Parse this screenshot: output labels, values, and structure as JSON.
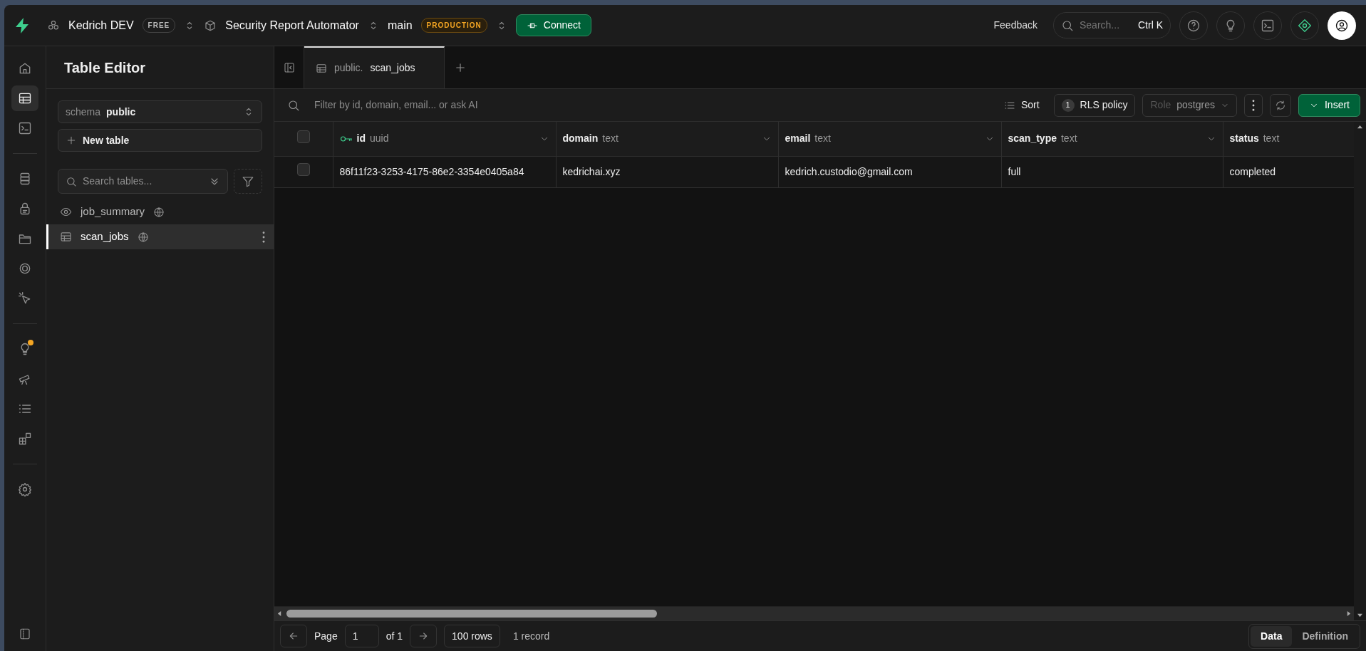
{
  "topbar": {
    "org": "Kedrich DEV",
    "org_badge": "FREE",
    "project": "Security Report Automator",
    "branch": "main",
    "branch_badge": "PRODUCTION",
    "connect": "Connect",
    "feedback": "Feedback",
    "search_placeholder": "Search...",
    "search_shortcut": "Ctrl K"
  },
  "rail_groups": [
    [
      {
        "kind": "home",
        "selected": false,
        "notification": false
      },
      {
        "kind": "table",
        "selected": true,
        "notification": false
      },
      {
        "kind": "terminal",
        "selected": false,
        "notification": false
      }
    ],
    [
      {
        "kind": "database",
        "selected": false,
        "notification": false
      },
      {
        "kind": "lock",
        "selected": false,
        "notification": false
      },
      {
        "kind": "folder",
        "selected": false,
        "notification": false
      },
      {
        "kind": "orbit",
        "selected": false,
        "notification": false
      },
      {
        "kind": "cursor",
        "selected": false,
        "notification": false
      }
    ],
    [
      {
        "kind": "bulb",
        "selected": false,
        "notification": true
      },
      {
        "kind": "telescope",
        "selected": false,
        "notification": false
      },
      {
        "kind": "list",
        "selected": false,
        "notification": false
      },
      {
        "kind": "blocks",
        "selected": false,
        "notification": false
      }
    ],
    [
      {
        "kind": "gear",
        "selected": false,
        "notification": false
      }
    ]
  ],
  "sidebar": {
    "title": "Table Editor",
    "schema_label": "schema",
    "schema_value": "public",
    "new_table": "New table",
    "search_placeholder": "Search tables...",
    "tables": [
      {
        "name": "job_summary",
        "kind": "view",
        "selected": false
      },
      {
        "name": "scan_jobs",
        "kind": "table",
        "selected": true
      }
    ]
  },
  "tabs": [
    {
      "schema": "public.",
      "name": "scan_jobs",
      "selected": true
    }
  ],
  "toolbar": {
    "filter_placeholder": "Filter by id, domain, email... or ask AI",
    "sort": "Sort",
    "rls_count": "1",
    "rls": "RLS policy",
    "role_label": "Role",
    "role": "postgres",
    "insert": "Insert"
  },
  "table": {
    "all_selected": false,
    "columns": [
      {
        "name": "id",
        "type": "uuid",
        "primary_key": true
      },
      {
        "name": "domain",
        "type": "text",
        "primary_key": false
      },
      {
        "name": "email",
        "type": "text",
        "primary_key": false
      },
      {
        "name": "scan_type",
        "type": "text",
        "primary_key": false
      },
      {
        "name": "status",
        "type": "text",
        "primary_key": false
      }
    ],
    "rows": [
      {
        "selected": false,
        "cells": [
          "86f11f23-3253-4175-86e2-3354e0405a84",
          "kedrichai.xyz",
          "kedrich.custodio@gmail.com",
          "full",
          "completed"
        ]
      }
    ]
  },
  "footer": {
    "page_label": "Page",
    "page": "1",
    "of": "of 1",
    "rows": "100 rows",
    "records": "1 record",
    "views": [
      {
        "label": "Data",
        "selected": true
      },
      {
        "label": "Definition",
        "selected": false
      }
    ]
  }
}
